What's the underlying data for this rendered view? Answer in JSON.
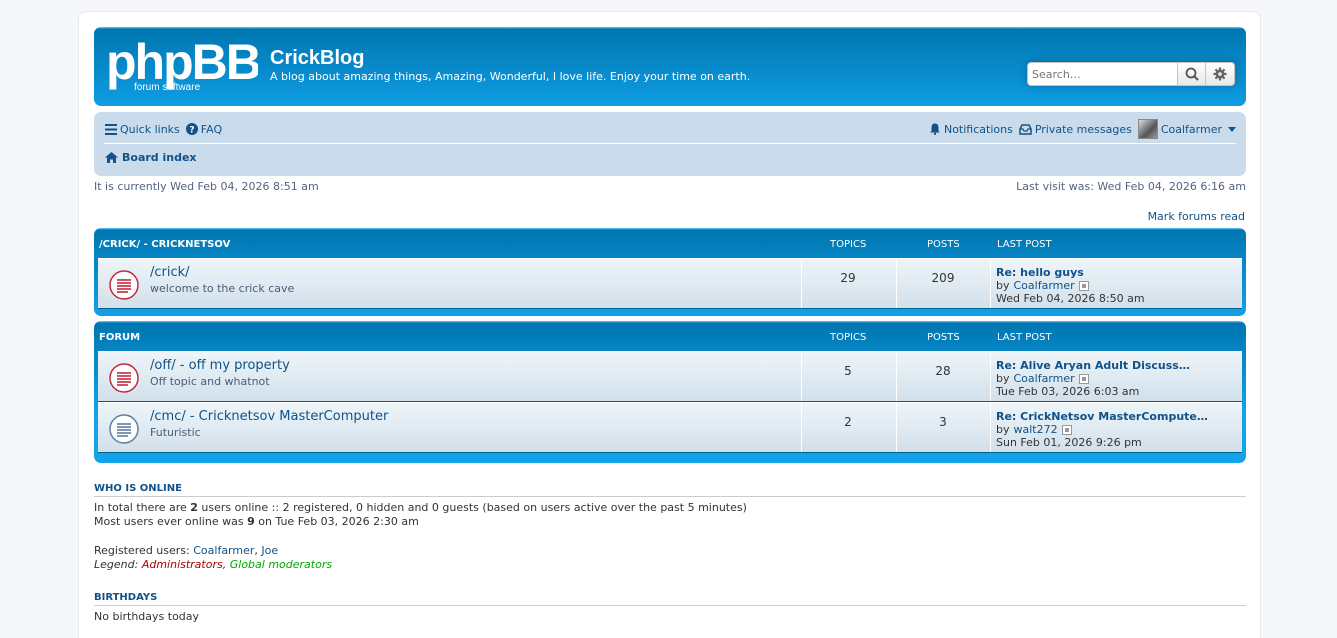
{
  "header": {
    "logo_text": "phpBB",
    "logo_sub": "forum software",
    "site_title": "CrickBlog",
    "site_desc": "A blog about amazing things, Amazing, Wonderful, I love life. Enjoy your time on earth.",
    "search_placeholder": "Search…"
  },
  "navbar": {
    "quick_links": "Quick links",
    "faq": "FAQ",
    "notifications": "Notifications",
    "private_messages": "Private messages",
    "username": "Coalfarmer",
    "board_index": "Board index"
  },
  "time": {
    "current": "It is currently Wed Feb 04, 2026 8:51 am",
    "last_visit": "Last visit was: Wed Feb 04, 2026 6:16 am",
    "mark_read": "Mark forums read"
  },
  "categories": [
    {
      "title": "/CRICK/ - CRICKNETSOV",
      "col_topics": "TOPICS",
      "col_posts": "POSTS",
      "col_last": "LAST POST",
      "forums": [
        {
          "title": "/crick/",
          "desc": "welcome to the crick cave",
          "topics": "29",
          "posts": "209",
          "lp_title": "Re: hello guys",
          "lp_by": "by",
          "lp_user": "Coalfarmer",
          "lp_date": "Wed Feb 04, 2026 8:50 am"
        }
      ]
    },
    {
      "title": "FORUM",
      "col_topics": "TOPICS",
      "col_posts": "POSTS",
      "col_last": "LAST POST",
      "forums": [
        {
          "title": "/off/ - off my property",
          "desc": "Off topic and whatnot",
          "topics": "5",
          "posts": "28",
          "lp_title": "Re: Alive Aryan Adult Discuss…",
          "lp_by": "by",
          "lp_user": "Coalfarmer",
          "lp_date": "Tue Feb 03, 2026 6:03 am"
        },
        {
          "title": "/cmc/ - Cricknetsov MasterComputer",
          "desc": "Futuristic",
          "topics": "2",
          "posts": "3",
          "lp_title": "Re: CrickNetsov MasterCompute…",
          "lp_by": "by",
          "lp_user": "walt272",
          "lp_date": "Sun Feb 01, 2026 9:26 pm"
        }
      ]
    }
  ],
  "who_online": {
    "heading": "WHO IS ONLINE",
    "line1_a": "In total there are ",
    "line1_b": "2",
    "line1_c": " users online :: 2 registered, 0 hidden and 0 guests (based on users active over the past 5 minutes)",
    "line2_a": "Most users ever online was ",
    "line2_b": "9",
    "line2_c": " on Tue Feb 03, 2026 2:30 am",
    "registered_label": "Registered users: ",
    "user1": "Coalfarmer",
    "comma": ", ",
    "user2": "Joe",
    "legend_label": "Legend: ",
    "legend_admin": "Administrators",
    "legend_gmod": "Global moderators"
  },
  "birthdays": {
    "heading": "BIRTHDAYS",
    "text": "No birthdays today"
  },
  "colors": {
    "header_blue": "#12a3eb",
    "nav_bg": "#cadceb",
    "link": "#105289",
    "unread_icon": "#c1293d",
    "read_icon": "#5d7fa0"
  }
}
